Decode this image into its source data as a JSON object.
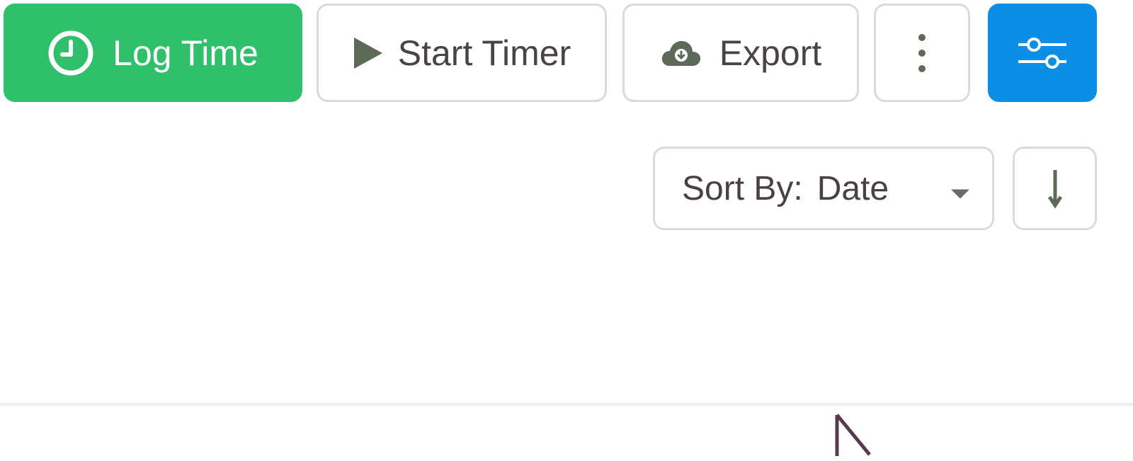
{
  "toolbar": {
    "log_time_label": "Log Time",
    "start_timer_label": "Start Timer",
    "export_label": "Export",
    "more_icon": "vertical-dots-icon",
    "filter_icon": "sliders-icon"
  },
  "sort": {
    "prefix": "Sort By:",
    "value": "Date",
    "direction_icon": "arrow-down-icon"
  },
  "colors": {
    "primary_green": "#30bf6b",
    "primary_blue": "#0b8ee6",
    "border": "#d6dbe2",
    "text": "#4a3f45"
  }
}
